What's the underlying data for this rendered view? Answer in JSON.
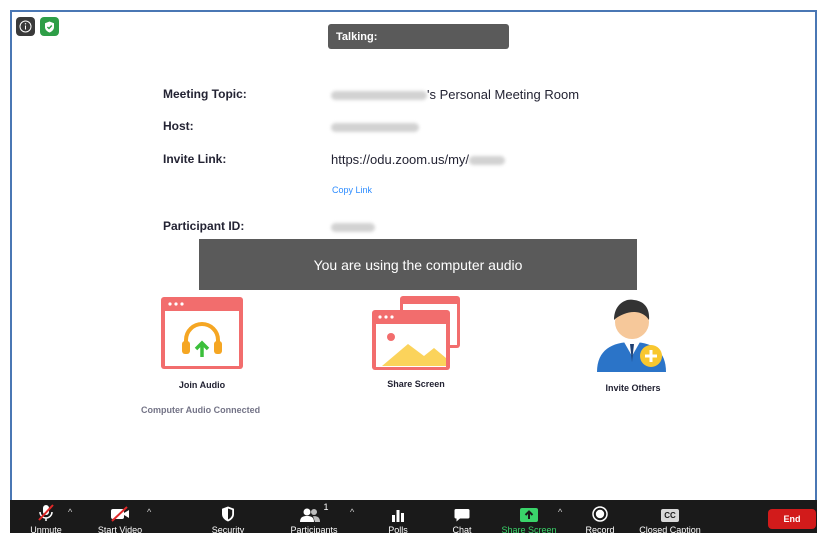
{
  "talking_label": "Talking:",
  "meeting": {
    "topic_label": "Meeting Topic:",
    "topic_suffix": "'s Personal Meeting Room",
    "host_label": "Host:",
    "invite_label": "Invite Link:",
    "invite_url": "https://odu.zoom.us/my/",
    "copy_link": "Copy Link",
    "participant_label": "Participant ID:"
  },
  "banner": "You are using the computer audio",
  "actions": {
    "join_audio": "Join Audio",
    "join_audio_sub": "Computer Audio Connected",
    "share_screen": "Share Screen",
    "invite_others": "Invite Others"
  },
  "toolbar": {
    "unmute": "Unmute",
    "start_video": "Start Video",
    "security": "Security",
    "participants": "Participants",
    "participants_count": "1",
    "polls": "Polls",
    "chat": "Chat",
    "share_screen": "Share Screen",
    "record": "Record",
    "closed_caption": "Closed Caption",
    "cc_glyph": "CC",
    "end": "End"
  },
  "colors": {
    "accent_blue": "#2d8cff",
    "share_green": "#3ad46a",
    "end_red": "#d21b1b",
    "card_red": "#f26d6d"
  }
}
